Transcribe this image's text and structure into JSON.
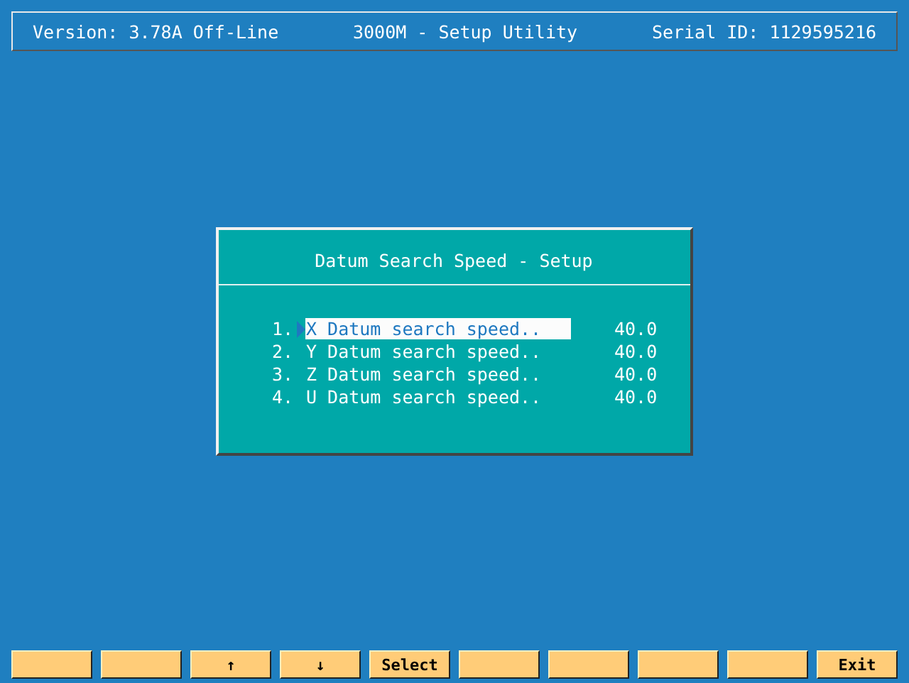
{
  "header": {
    "version": "Version: 3.78A Off-Line",
    "title": "3000M - Setup Utility",
    "serial": "Serial ID: 1129595216"
  },
  "dialog": {
    "title": "Datum Search Speed - Setup",
    "items": [
      {
        "number": "1.",
        "label": "X Datum search speed..",
        "value": "40.0",
        "selected": true
      },
      {
        "number": "2.",
        "label": "Y Datum search speed..",
        "value": "40.0",
        "selected": false
      },
      {
        "number": "3.",
        "label": "Z Datum search speed..",
        "value": "40.0",
        "selected": false
      },
      {
        "number": "4.",
        "label": "U Datum search speed..",
        "value": "40.0",
        "selected": false
      }
    ]
  },
  "function_keys": [
    {
      "kind": "blank"
    },
    {
      "kind": "blank"
    },
    {
      "kind": "label",
      "label": "↑"
    },
    {
      "kind": "label",
      "label": "↓"
    },
    {
      "kind": "label",
      "label": "Select"
    },
    {
      "kind": "blank"
    },
    {
      "kind": "blank"
    },
    {
      "kind": "blank"
    },
    {
      "kind": "blank"
    },
    {
      "kind": "label",
      "label": "Exit"
    }
  ]
}
